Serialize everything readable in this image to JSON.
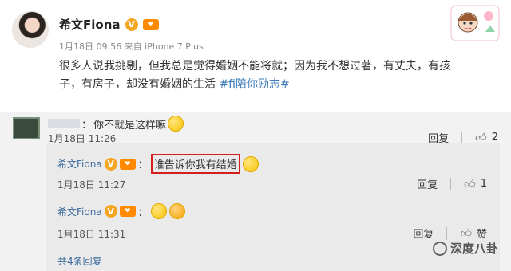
{
  "post": {
    "author": "希文Fiona",
    "meta": "1月18日 09:56 来自 iPhone 7 Plus",
    "text_line1": "很多人说我挑剔，但我总是觉得婚姻不能将就；因为我不想过著，有丈夫，有孩",
    "text_line2_prefix": "子，有房子，却没有婚姻的生活 ",
    "hashtag": "#fi陪你励志#"
  },
  "comments": [
    {
      "name": "",
      "sep": "：",
      "text": "你不就是这样嘛",
      "time": "1月18日 11:26",
      "reply_label": "回复",
      "likes": "2"
    },
    {
      "name": "希文Fiona",
      "sep": "：",
      "text": "谁告诉你我有结婚",
      "time": "1月18日 11:27",
      "reply_label": "回复",
      "likes": "1"
    },
    {
      "name": "希文Fiona",
      "sep": "：",
      "text": "",
      "time": "1月18日 11:31",
      "reply_label": "回复",
      "likes": "赞"
    }
  ],
  "more_replies": "共4条回复",
  "watermark": "深度八卦",
  "icons": {
    "verified": "V",
    "vip": "vip-icon",
    "like": "thumbs-up-icon",
    "emoji": "smiley-icon"
  },
  "colors": {
    "name_blue": "#3d6c9e",
    "hashtag_blue": "#3d7bb8",
    "highlight_red": "#d41f1f",
    "badge_orange": "#f5a623"
  }
}
